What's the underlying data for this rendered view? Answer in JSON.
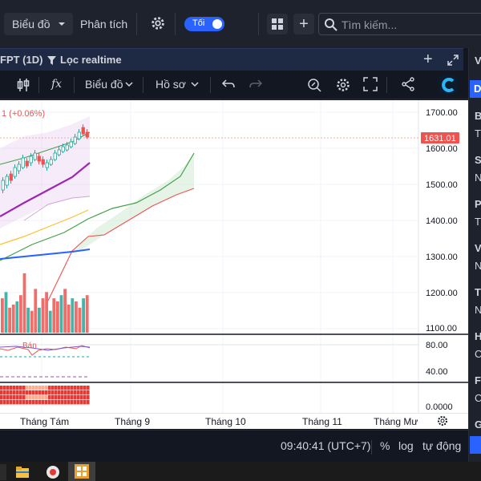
{
  "topbar": {
    "chart_select": "Biểu đồ",
    "analysis": "Phân tích",
    "theme_toggle": "Tối",
    "search_placeholder": "Tìm kiếm..."
  },
  "panel": {
    "symbol": "FPT (1D)",
    "filter_label": "Lọc realtime"
  },
  "toolbar": {
    "fx": "fx",
    "chart_menu": "Biểu đồ",
    "profile_menu": "Hồ sơ"
  },
  "chart": {
    "change_text": "1 (+0.06%)",
    "last_price_label": "1631.01",
    "price_ticks": [
      "1700.00",
      "1600.00",
      "1500.00",
      "1400.00",
      "1300.00",
      "1200.00",
      "1100.00"
    ],
    "rsi_ticks": [
      "80.00",
      "40.00"
    ],
    "rsi_signal": "Bán",
    "heat_tick": "0.0000",
    "time_ticks": [
      "Tháng Tám",
      "Tháng 9",
      "Tháng 10",
      "Tháng 11",
      "Tháng Mười"
    ]
  },
  "chart_data": {
    "type": "line",
    "ylim": [
      1080,
      1720
    ],
    "last_price": 1631.01,
    "series": [
      {
        "values": [
          1605,
          1640,
          1600,
          1625,
          1632
        ]
      },
      {
        "values": [
          1502,
          1520,
          1538,
          1555
        ]
      },
      {
        "values": [
          1386,
          1400,
          1430,
          1580
        ]
      }
    ],
    "volume": [
      55,
      65,
      40,
      45,
      50,
      60,
      95,
      40,
      35,
      70,
      40,
      55,
      65,
      35,
      55,
      50,
      60,
      70,
      45,
      55,
      50,
      40,
      55,
      60
    ]
  },
  "bottombar": {
    "time": "09:40:41 (UTC+7)",
    "percent": "%",
    "log": "log",
    "auto": "tự động"
  },
  "rightpanel": {
    "letters": [
      "V",
      "D",
      "B",
      "T",
      "S",
      "N",
      "P",
      "T",
      "V",
      "N",
      "T",
      "N",
      "H",
      "C",
      "F",
      "C",
      "G"
    ]
  },
  "colors": {
    "accent": "#2962ff",
    "up": "#26a69a",
    "down": "#ef5350",
    "ma_purple": "#9c27b0",
    "ma_blue": "#2962ff",
    "ma_yellow": "#fbc02d",
    "cloud_green": "#43a047"
  }
}
